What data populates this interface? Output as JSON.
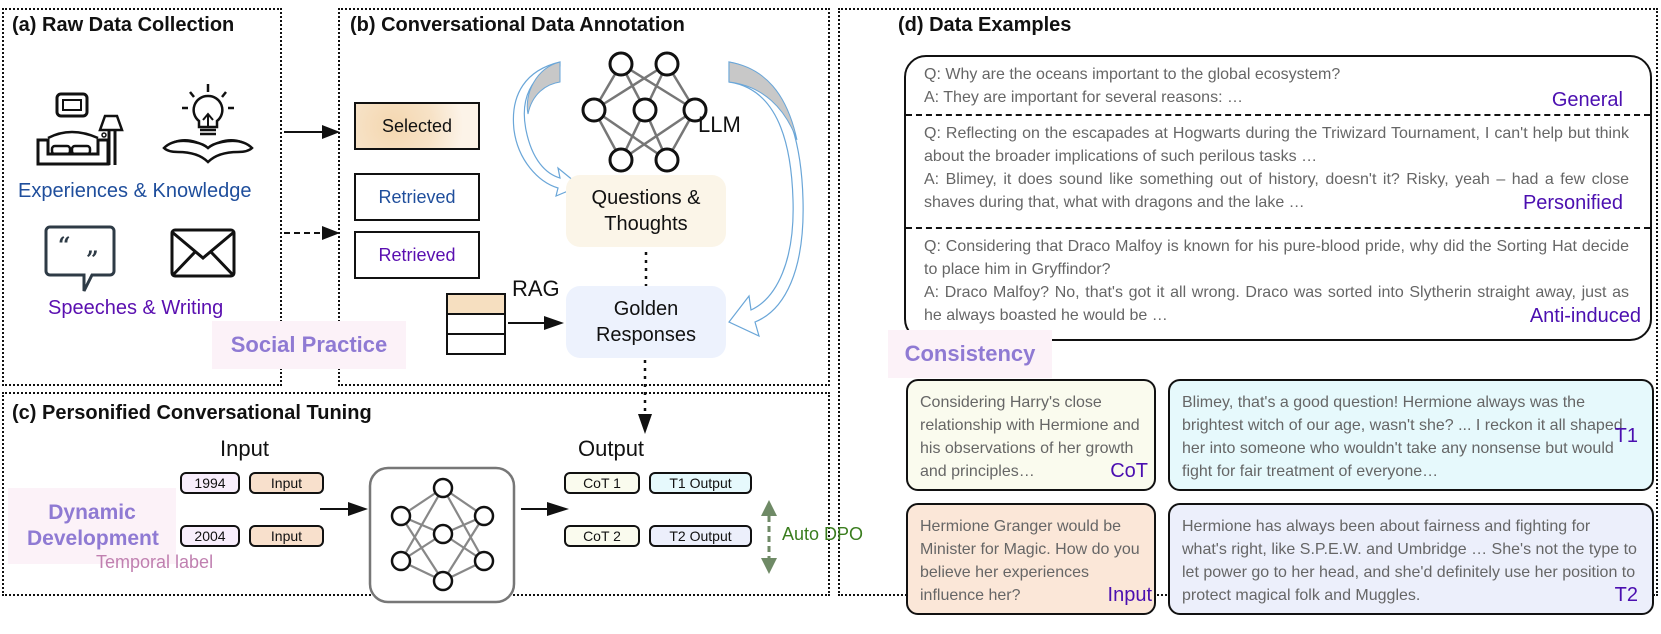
{
  "panel_a": {
    "title": "(a) Raw Data Collection",
    "group1_label": "Experiences & Knowledge",
    "group2_label": "Speeches & Writing",
    "icons": [
      "sofa-lamp-icon",
      "lightbulb-book-icon",
      "speech-bubble-quote-icon",
      "envelope-icon"
    ],
    "colors": {
      "group1": "#1f4e9c",
      "group2": "#5a0fb0"
    }
  },
  "social_practice": "Social Practice",
  "panel_b": {
    "title": "(b) Conversational Data Annotation",
    "selected_label": "Selected",
    "retrieved_1": "Retrieved",
    "retrieved_2": "Retrieved",
    "llm_label": "LLM",
    "rag_label": "RAG",
    "questions_box": "Questions & Thoughts",
    "golden_box": "Golden Responses",
    "colors": {
      "retrieved_1": "#1f4e9c",
      "retrieved_2": "#5a0fb0",
      "questions_bg": "#fbf5e8",
      "golden_bg": "#edf2fd"
    }
  },
  "panel_c": {
    "title": "(c) Personified Conversational Tuning",
    "input_heading": "Input",
    "output_heading": "Output",
    "dynamic_development": "Dynamic Development",
    "temporal_label": "Temporal label",
    "rows": [
      {
        "year": "1994",
        "input": "Input",
        "cot": "CoT 1",
        "output": "T1 Output"
      },
      {
        "year": "2004",
        "input": "Input",
        "cot": "CoT 2",
        "output": "T2 Output"
      }
    ],
    "auto_dpo": "Auto DPO",
    "colors": {
      "auto_dpo": "#3a7d1e",
      "temporal_label": "#c080b0"
    }
  },
  "panel_d": {
    "title": "(d) Data Examples",
    "examples": [
      {
        "q": "Q: Why are the oceans important to the global ecosystem?",
        "a": "A: They are important for several reasons: …",
        "tag": "General"
      },
      {
        "q": "Q: Reflecting on the escapades at Hogwarts during the Triwizard Tournament, I can't help but think about the broader implications of such perilous tasks …",
        "a": "A: Blimey, it does sound like something out of history, doesn't it? Risky, yeah – had a few close shaves during that, what with dragons and the lake …",
        "tag": "Personified"
      },
      {
        "q": "Q: Considering that Draco Malfoy is known for his pure-blood pride, why did the Sorting Hat decide to place him in Gryffindor?",
        "a": "A: Draco Malfoy? No, that's got it all wrong. Draco was sorted into Slytherin straight away, just as he always boasted he would be …",
        "tag": "Anti-induced"
      }
    ],
    "consistency": "Consistency",
    "cards": {
      "cot": {
        "text": "Considering Harry's close relationship with Hermione and his observations of her growth and principles…",
        "tag": "CoT"
      },
      "t1": {
        "text": "Blimey, that's a good question! Hermione always was the brightest witch of our age, wasn't she? ... I reckon it all shaped her into someone who wouldn't take any nonsense but would fight for fair treatment of everyone…",
        "tag": "T1"
      },
      "input": {
        "text": "Hermione Granger would be Minister for Magic. How do you believe her experiences influence her?",
        "tag": "Input"
      },
      "t2": {
        "text": "Hermione has always been about fairness and fighting for what's right, like S.P.E.W. and Umbridge … She's not the type to let power go to her head, and she'd definitely use her position to protect magical folk and Muggles.",
        "tag": "T2"
      }
    },
    "colors": {
      "cot_bg": "#fafbee",
      "t1_bg": "#e6f9fc",
      "input_bg": "#fbe7d8",
      "t2_bg": "#eceffb",
      "tag": "#4b0fb0"
    }
  }
}
